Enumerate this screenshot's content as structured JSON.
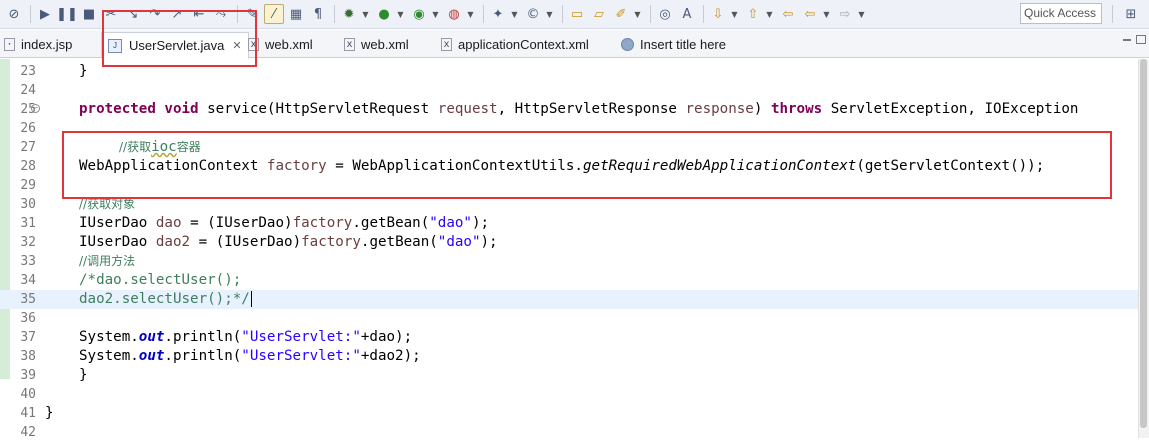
{
  "toolbar": {
    "icons": [
      "toggle-breakpoints-icon",
      "resume-icon",
      "suspend-icon",
      "terminate-icon",
      "disconnect-icon",
      "step-into-icon",
      "step-over-icon",
      "step-return-icon",
      "drop-to-frame-icon",
      "use-step-filters-icon",
      "toggle-mark-occurrences-icon",
      "toggle-word-wrap-icon",
      "toggle-block-selection-icon",
      "show-whitespace-icon",
      "debug-icon",
      "run-icon",
      "run-server-icon",
      "external-tools-icon",
      "new-wizard-icon",
      "new-java-class-icon",
      "open-type-icon",
      "open-task-icon",
      "search-icon",
      "annotation-next-icon",
      "annotation-prev-icon",
      "last-edit-icon",
      "back-icon",
      "forward-icon"
    ],
    "quick_access": "Quick Access"
  },
  "tabs": [
    {
      "label": "index.jsp",
      "icon": "jsp-file-icon"
    },
    {
      "label": "UserServlet.java",
      "icon": "java-file-icon",
      "selected": true
    },
    {
      "label": "web.xml",
      "icon": "xml-file-icon"
    },
    {
      "label": "web.xml",
      "icon": "xml-file-icon"
    },
    {
      "label": "applicationContext.xml",
      "icon": "xml-file-icon"
    },
    {
      "label": "Insert title here",
      "icon": "web-browser-icon"
    }
  ],
  "editor": {
    "current_line": 35,
    "lines": [
      {
        "n": "23"
      },
      {
        "n": "24"
      },
      {
        "n": "25",
        "fold": "⊖"
      },
      {
        "n": "26"
      },
      {
        "n": "27"
      },
      {
        "n": "28"
      },
      {
        "n": "29"
      },
      {
        "n": "30"
      },
      {
        "n": "31"
      },
      {
        "n": "32"
      },
      {
        "n": "33"
      },
      {
        "n": "34"
      },
      {
        "n": "35"
      },
      {
        "n": "36"
      },
      {
        "n": "37"
      },
      {
        "n": "38"
      },
      {
        "n": "39"
      },
      {
        "n": "40"
      },
      {
        "n": "41"
      },
      {
        "n": "42"
      }
    ],
    "code": {
      "l23": "}",
      "l25_kw1": "protected",
      "l25_kw2": "void",
      "l25_a": "service(HttpServletRequest",
      "l25_p1": "request",
      "l25_b": ", HttpServletResponse",
      "l25_p2": "response",
      "l25_c": ")",
      "l25_kw3": "throws",
      "l25_d": "ServletException, IOException",
      "l27_c1": "//获取",
      "l27_c2": "ioc",
      "l27_c3": "容器",
      "l28_a": "WebApplicationContext",
      "l28_v": "factory",
      "l28_b": "= WebApplicationContextUtils.",
      "l28_m": "getRequiredWebApplicationContext",
      "l28_c": "(getServletContext());",
      "l30": "//获取对象",
      "l31_a": "IUserDao",
      "l31_v": "dao",
      "l31_b": "= (IUserDao)",
      "l31_f": "factory",
      "l31_c": ".getBean(",
      "l31_s": "\"dao\"",
      "l31_d": ");",
      "l32_a": "IUserDao",
      "l32_v": "dao2",
      "l32_b": "= (IUserDao)",
      "l32_f": "factory",
      "l32_c": ".getBean(",
      "l32_s": "\"dao\"",
      "l32_d": ");",
      "l33": "//调用方法",
      "l34": "/*dao.selectUser();",
      "l35": "dao2.selectUser();*/",
      "l37_a": "System.",
      "l37_o": "out",
      "l37_b": ".println(",
      "l37_s": "\"UserServlet:\"",
      "l37_c": "+dao);",
      "l38_a": "System.",
      "l38_o": "out",
      "l38_b": ".println(",
      "l38_s": "\"UserServlet:\"",
      "l38_c": "+dao2);",
      "l39": "}",
      "l41": "}"
    }
  },
  "colors": {
    "keyword": "#7f0055",
    "string": "#2a00ff",
    "comment": "#3f7f5f",
    "field": "#0000c0",
    "parameter": "#6a3e3e",
    "highlight_box": "#e0353b",
    "current_line": "#e8f2fe"
  }
}
